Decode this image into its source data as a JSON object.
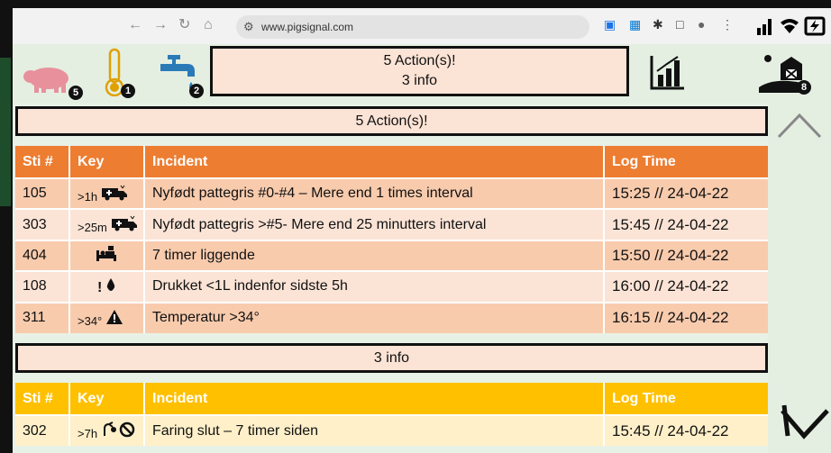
{
  "browser": {
    "url": "www.pigsignal.com",
    "back_icon": "arrow-left-icon",
    "forward_icon": "arrow-right-icon",
    "reload_icon": "reload-icon",
    "home_icon": "home-icon"
  },
  "icon_bar": {
    "pig_count": "5",
    "temperature_count": "1",
    "water_count": "2",
    "barn_count": "8"
  },
  "summary": {
    "actions": "5 Action(s)!",
    "info": "3 info"
  },
  "actions_section": {
    "title": "5 Action(s)!",
    "headers": [
      "Sti #",
      "Key",
      "Incident",
      "Log Time"
    ],
    "rows": [
      {
        "sti": "105",
        "key": ">1h",
        "key_icon": "ambulance-icon",
        "incident": "Nyfødt pattegris #0-#4 – Mere end 1 times interval",
        "time": "15:25 // 24-04-22"
      },
      {
        "sti": "303",
        "key": ">25m",
        "key_icon": "ambulance-icon",
        "incident": "Nyfødt pattegris >#5- Mere end 25 minutters interval",
        "time": "15:45 // 24-04-22"
      },
      {
        "sti": "404",
        "key": "",
        "key_icon": "bed-icon",
        "incident": "7 timer liggende",
        "time": "15:50 // 24-04-22"
      },
      {
        "sti": "108",
        "key": "!",
        "key_icon": "water-drop-icon",
        "incident": "Drukket <1L indenfor sidste 5h",
        "time": "16:00 // 24-04-22"
      },
      {
        "sti": "311",
        "key": ">34°",
        "key_icon": "warning-icon",
        "incident": "Temperatur >34°",
        "time": "16:15 // 24-04-22"
      }
    ]
  },
  "info_section": {
    "title": "3 info",
    "headers": [
      "Sti #",
      "Key",
      "Incident",
      "Log Time"
    ],
    "rows": [
      {
        "sti": "302",
        "key": ">7h",
        "key_icon": "no-farrowing-icon",
        "incident": "Faring slut – 7 timer siden",
        "time": "15:45 // 24-04-22"
      }
    ]
  },
  "colors": {
    "actions_header": "#ed7d31",
    "info_header": "#ffc000",
    "summary_bg": "#fbe3d5"
  }
}
